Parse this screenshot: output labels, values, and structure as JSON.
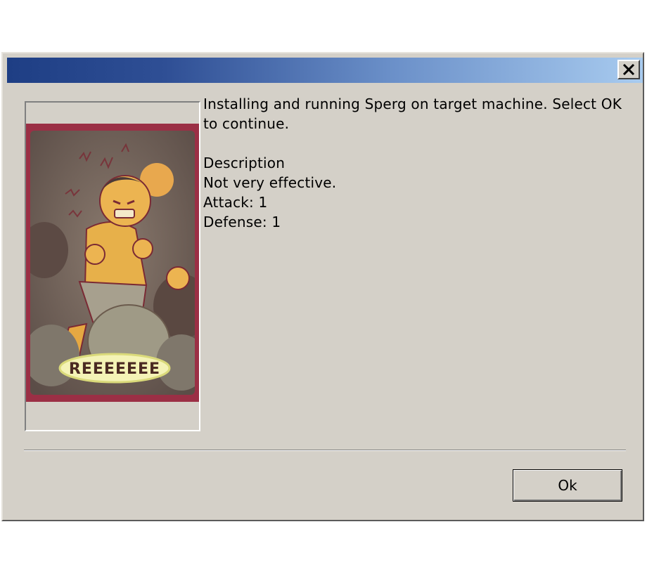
{
  "dialog": {
    "title": "",
    "close_icon": "close-x-icon",
    "colors": {
      "face": "#d4d0c8",
      "titlebar_start": "#1e3e84",
      "titlebar_end": "#a8cbef",
      "card_border": "#9b2f45"
    }
  },
  "card": {
    "caption": "REEEEEEE"
  },
  "message": {
    "line1": "Installing and running Sperg on target machine. Select OK to continue.",
    "description_heading": "Description",
    "description_text": "Not very effective.",
    "attack": "Attack: 1",
    "defense": "Defense: 1"
  },
  "buttons": {
    "ok_label": "Ok"
  }
}
